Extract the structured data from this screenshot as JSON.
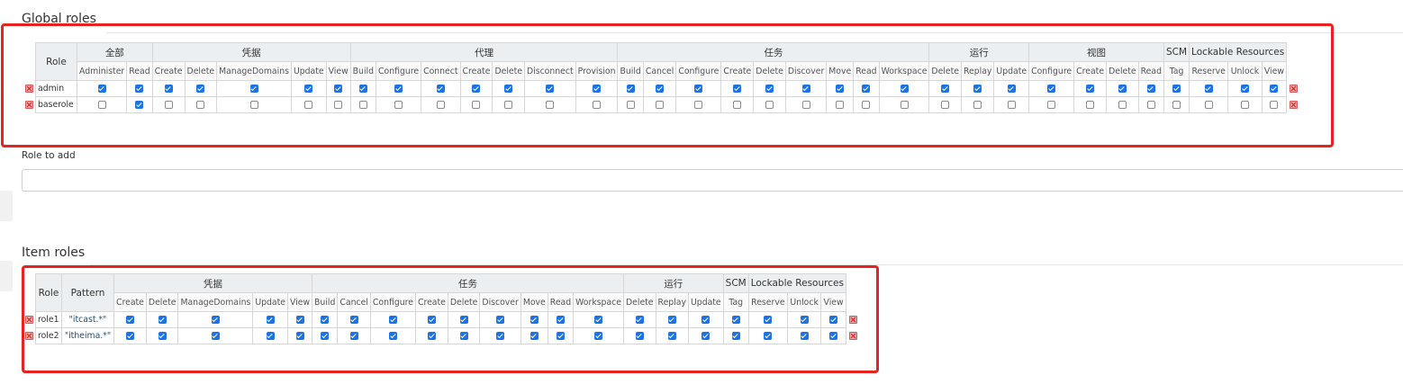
{
  "global": {
    "title": "Global roles",
    "role_header": "Role",
    "groups": [
      {
        "label": "全部",
        "perms": [
          "Administer",
          "Read"
        ]
      },
      {
        "label": "凭据",
        "perms": [
          "Create",
          "Delete",
          "ManageDomains",
          "Update",
          "View"
        ]
      },
      {
        "label": "代理",
        "perms": [
          "Build",
          "Configure",
          "Connect",
          "Create",
          "Delete",
          "Disconnect",
          "Provision"
        ]
      },
      {
        "label": "任务",
        "perms": [
          "Build",
          "Cancel",
          "Configure",
          "Create",
          "Delete",
          "Discover",
          "Move",
          "Read",
          "Workspace"
        ]
      },
      {
        "label": "运行",
        "perms": [
          "Delete",
          "Replay",
          "Update"
        ]
      },
      {
        "label": "视图",
        "perms": [
          "Configure",
          "Create",
          "Delete",
          "Read"
        ]
      },
      {
        "label": "SCM",
        "perms": [
          "Tag"
        ]
      },
      {
        "label": "Lockable Resources",
        "perms": [
          "Reserve",
          "Unlock",
          "View"
        ]
      }
    ],
    "rows": [
      {
        "name": "admin",
        "checks": [
          1,
          1,
          1,
          1,
          1,
          1,
          1,
          1,
          1,
          1,
          1,
          1,
          1,
          1,
          1,
          1,
          1,
          1,
          1,
          1,
          1,
          1,
          1,
          1,
          1,
          1,
          1,
          1,
          1,
          1,
          1,
          1,
          1,
          1
        ]
      },
      {
        "name": "baserole",
        "checks": [
          0,
          1,
          0,
          0,
          0,
          0,
          0,
          0,
          0,
          0,
          0,
          0,
          0,
          0,
          0,
          0,
          0,
          0,
          0,
          0,
          0,
          0,
          0,
          0,
          0,
          0,
          0,
          0,
          0,
          0,
          0,
          0,
          0,
          0
        ]
      }
    ]
  },
  "role_to_add": {
    "label": "Role to add",
    "value": ""
  },
  "item": {
    "title": "Item roles",
    "role_header": "Role",
    "pattern_header": "Pattern",
    "groups": [
      {
        "label": "凭据",
        "perms": [
          "Create",
          "Delete",
          "ManageDomains",
          "Update",
          "View"
        ]
      },
      {
        "label": "任务",
        "perms": [
          "Build",
          "Cancel",
          "Configure",
          "Create",
          "Delete",
          "Discover",
          "Move",
          "Read",
          "Workspace"
        ]
      },
      {
        "label": "运行",
        "perms": [
          "Delete",
          "Replay",
          "Update"
        ]
      },
      {
        "label": "SCM",
        "perms": [
          "Tag"
        ]
      },
      {
        "label": "Lockable Resources",
        "perms": [
          "Reserve",
          "Unlock",
          "View"
        ]
      }
    ],
    "rows": [
      {
        "name": "role1",
        "pattern": "\"itcast.*\"",
        "checks": [
          1,
          1,
          1,
          1,
          1,
          1,
          1,
          1,
          1,
          1,
          1,
          1,
          1,
          1,
          1,
          1,
          1,
          1,
          1,
          1,
          1
        ]
      },
      {
        "name": "role2",
        "pattern": "\"itheima.*\"",
        "checks": [
          1,
          1,
          1,
          1,
          1,
          1,
          1,
          1,
          1,
          1,
          1,
          1,
          1,
          1,
          1,
          1,
          1,
          1,
          1,
          1,
          1
        ]
      }
    ]
  },
  "colors": {
    "highlight_border": "#e8231f",
    "checkbox_checked": "#1a73e8",
    "header_bg": "#eceff1"
  }
}
